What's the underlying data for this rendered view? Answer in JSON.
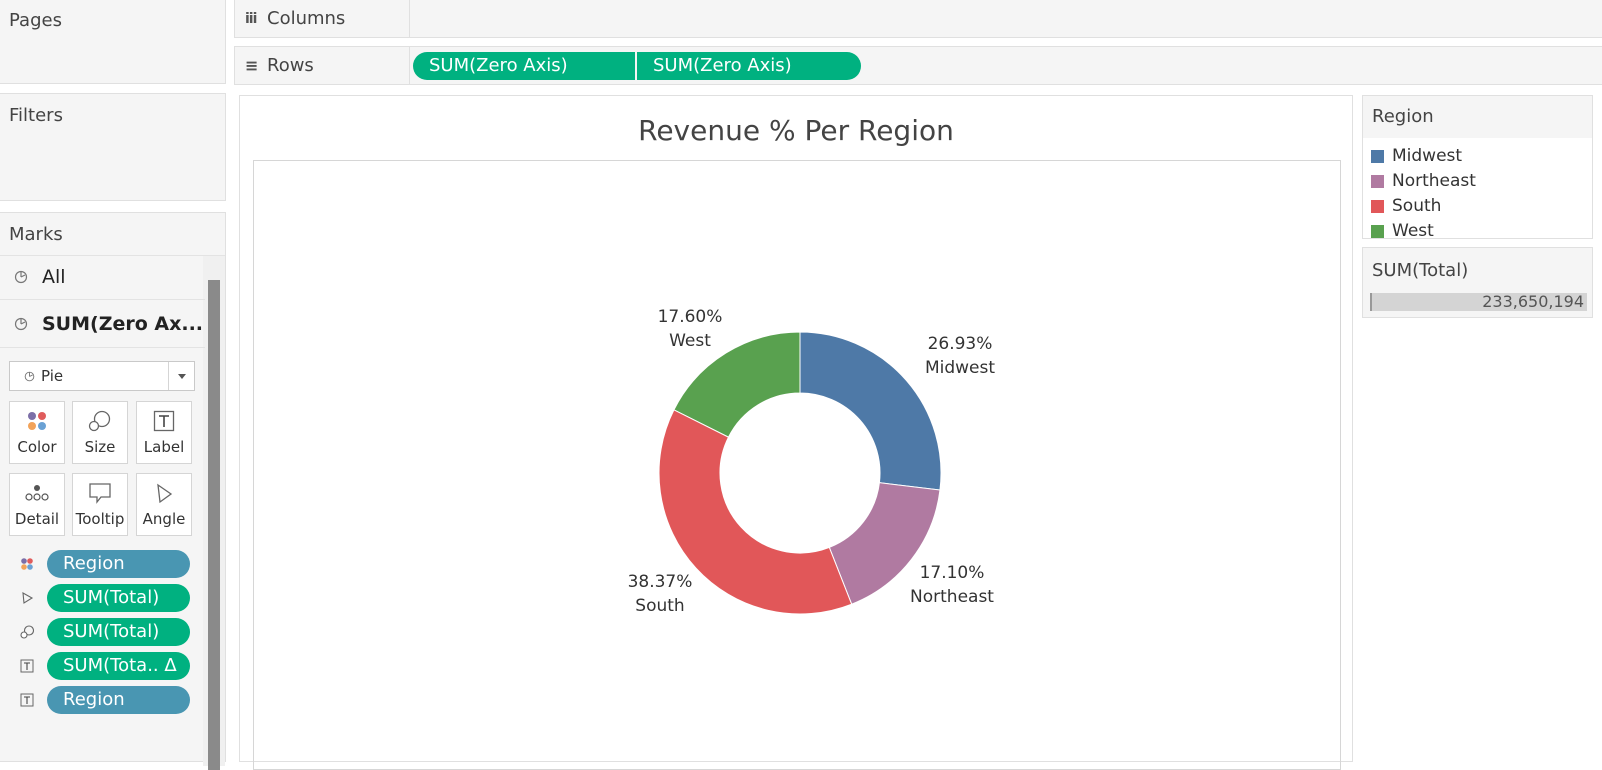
{
  "pages": {
    "title": "Pages"
  },
  "filters": {
    "title": "Filters"
  },
  "shelves": {
    "columns": {
      "icon": "iii",
      "label": "Columns"
    },
    "rows": {
      "icon": "≡",
      "label": "Rows",
      "pills": [
        "SUM(Zero Axis)",
        "SUM(Zero Axis)"
      ]
    }
  },
  "marks": {
    "title": "Marks",
    "cards": [
      {
        "label": "All",
        "icon": "pie-icon"
      },
      {
        "label": "SUM(Zero Ax...",
        "icon": "pie-icon"
      }
    ],
    "mark_type": "Pie",
    "buttons": [
      {
        "label": "Color",
        "icon": "color-dots-icon"
      },
      {
        "label": "Size",
        "icon": "size-icon"
      },
      {
        "label": "Label",
        "icon": "label-icon"
      },
      {
        "label": "Detail",
        "icon": "detail-dots-icon"
      },
      {
        "label": "Tooltip",
        "icon": "tooltip-icon"
      },
      {
        "label": "Angle",
        "icon": "angle-icon"
      }
    ],
    "fields": [
      {
        "label": "Region",
        "type": "dimension",
        "icon": "color-dots-icon"
      },
      {
        "label": "SUM(Total)",
        "type": "measure",
        "icon": "angle-icon"
      },
      {
        "label": "SUM(Total)",
        "type": "measure",
        "icon": "size-icon"
      },
      {
        "label": "SUM(Tota.. Δ",
        "type": "measure",
        "icon": "label-icon"
      },
      {
        "label": "Region",
        "type": "dimension",
        "icon": "label-icon"
      }
    ]
  },
  "legend": {
    "title": "Region",
    "items": [
      {
        "label": "Midwest",
        "color": "#4e79a7"
      },
      {
        "label": "Northeast",
        "color": "#b07aa1"
      },
      {
        "label": "South",
        "color": "#e15759"
      },
      {
        "label": "West",
        "color": "#59a14f"
      }
    ]
  },
  "size_legend": {
    "title": "SUM(Total)",
    "value": "233,650,194"
  },
  "chart_data": {
    "type": "pie",
    "title": "Revenue % Per Region",
    "donut": true,
    "slices": [
      {
        "label": "Midwest",
        "value": 26.93,
        "text": "26.93%",
        "color": "#4e79a7"
      },
      {
        "label": "Northeast",
        "value": 17.1,
        "text": "17.10%",
        "color": "#b07aa1"
      },
      {
        "label": "South",
        "value": 38.37,
        "text": "38.37%",
        "color": "#e15759"
      },
      {
        "label": "West",
        "value": 17.6,
        "text": "17.60%",
        "color": "#59a14f"
      }
    ]
  }
}
